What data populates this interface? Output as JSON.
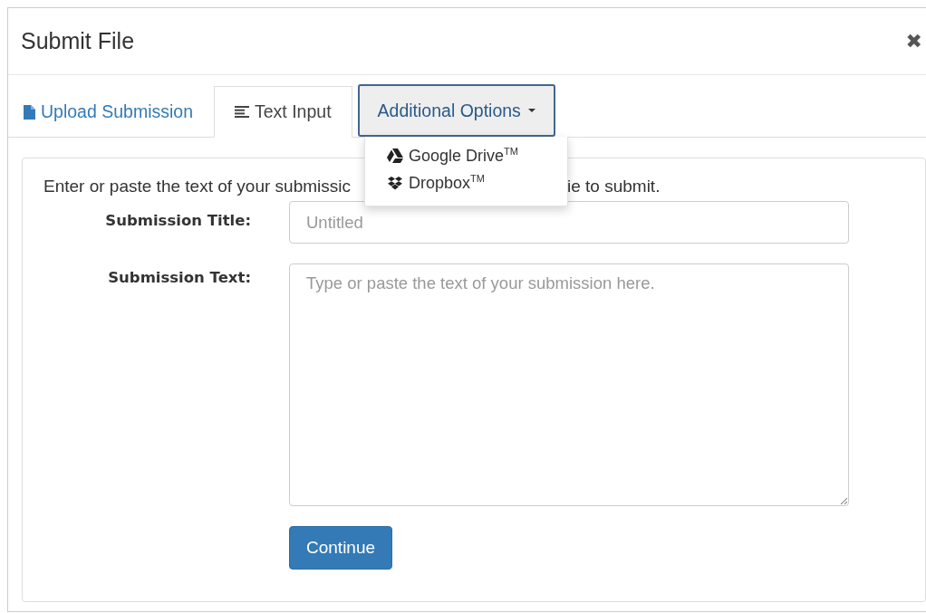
{
  "dialog": {
    "title": "Submit File",
    "close": "✖"
  },
  "tabs": [
    {
      "label": "Upload Submission",
      "kind": "link",
      "selected": false
    },
    {
      "label": "Text Input",
      "kind": "tab",
      "selected": true
    },
    {
      "label": "Additional Options",
      "kind": "dropdown",
      "selected": false,
      "expanded": true
    }
  ],
  "menu": [
    {
      "label": "Google Drive$^{TM}$",
      "kind": "drive"
    },
    {
      "label": "Dropbox$^{TM}$",
      "kind": "dropbox"
    }
  ],
  "instructions": [
    "Enter or paste the text of your submissic",
    "ie to submit."
  ],
  "form": {
    "title_label": "Submission Title:",
    "title_placeholder": "Untitled",
    "text_label": "Submission Text:",
    "text_placeholder": "Type or paste the text of your submission here.",
    "button": "Continue"
  }
}
